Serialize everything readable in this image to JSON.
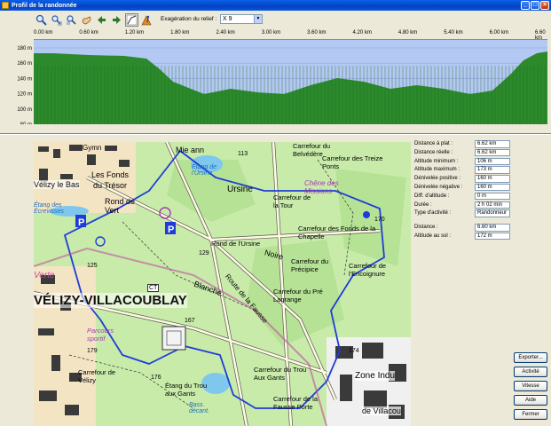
{
  "window": {
    "title": "Profil de la randonnée"
  },
  "window_buttons": {
    "minimize": "_",
    "maximize": "□",
    "close": "×"
  },
  "toolbar": {
    "icons": [
      "zoom-in-icon",
      "zoom-out-icon",
      "zoom-out-more-icon",
      "hand-pan-icon",
      "arrow-left-icon",
      "arrow-right-icon",
      "grid-icon",
      "hiker-icon"
    ],
    "exaggeration_label": "Exagération du relief :",
    "exaggeration_value": "X 9"
  },
  "profile": {
    "distance_ticks": [
      "0.00 km",
      "0.60 km",
      "1.20 km",
      "1.80 km",
      "2.40 km",
      "3.00 km",
      "3.60 km",
      "4.20 km",
      "4.80 km",
      "5.40 km",
      "6.00 km",
      "6.60 km"
    ],
    "altitude_ticks": [
      "180 m",
      "160 m",
      "140 m",
      "120 m",
      "100 m",
      "80 m"
    ],
    "fill_color": "#2c8a2c",
    "sky_color": "#b4c8f4"
  },
  "stats": [
    {
      "label": "Distance à plat :",
      "value": "6.62 km"
    },
    {
      "label": "Distance réelle :",
      "value": "6.62 km"
    },
    {
      "label": "Altitude minimum :",
      "value": "106 m"
    },
    {
      "label": "Altitude maximum :",
      "value": "173 m"
    },
    {
      "label": "Dénivelée positive :",
      "value": "160 m"
    },
    {
      "label": "Dénivelée négative :",
      "value": "160 m"
    },
    {
      "label": "Diff. d'altitude :",
      "value": "0 m"
    },
    {
      "label": "Durée :",
      "value": "2 h 02 min"
    },
    {
      "label": "Type d'activité :",
      "value": "Randonneur"
    }
  ],
  "cursor_stats": [
    {
      "label": "Distance :",
      "value": "6.60 km"
    },
    {
      "label": "Altitude au sol :",
      "value": "172 m"
    }
  ],
  "buttons": {
    "export": "Exporter...",
    "activity": "Activité",
    "speed": "Vitesse",
    "help": "Aide",
    "close": "Fermer"
  },
  "map_labels": {
    "velizy_bas": "Vélizy le Bas",
    "velizy_villacoublay": "VÉLIZY-VILLACOUBLAY",
    "les_fonds": "Les Fonds",
    "du_tresor": "du Trésor",
    "rond_de_vert": "Rond de Vert",
    "etang_ecrevisses": "Étang des Écrevisses",
    "etang_ursine": "Étang de l'Ursine",
    "rond_ursine": "Rond de l'Ursine",
    "carrefour_belvedere": "Carrefour du Belvédère",
    "carrefour_treize_ponts": "Carrefour des Treize Ponts",
    "chene_missions": "Chêne des Missions",
    "carrefour_tour": "Carrefour de la Tour",
    "carrefour_fond_chapelle": "Carrefour des Fonds de la Chapelle",
    "carrefour_precipice": "Carrefour du Précipice",
    "carrefour_encoignure": "Carrefour de l'Encoignure",
    "carrefour_pre_lagrange": "Carrefour du Pré Lagrange",
    "carrefour_velizy": "Carrefour de Vélizy",
    "carrefour_trou_gants": "Carrefour du Trou Aux Gants",
    "carrefour_fausse_porte": "Carrefour de la Fausse Porte",
    "etang_trou_gants": "Étang du Trou aux Gants",
    "parcours_sportif": "Parcours sportif",
    "zone_indu": "Zone Indu",
    "de_villac": "de Villacou",
    "allee_verte": "Verte",
    "noire": "Noire",
    "blanche": "Blanche",
    "route_fausse": "Route de la Fausse",
    "mie_ann": "Mie ann",
    "gymn": "Gymn",
    "num_113": "113",
    "num_129": "129",
    "num_125": "125",
    "num_167": "167",
    "num_174": "174",
    "num_170": "170",
    "num_176": "176",
    "num_179": "179",
    "ct": "CT",
    "ursine": "Ursine",
    "tour": "Tour",
    "bass_decant": "Bass. décant."
  }
}
